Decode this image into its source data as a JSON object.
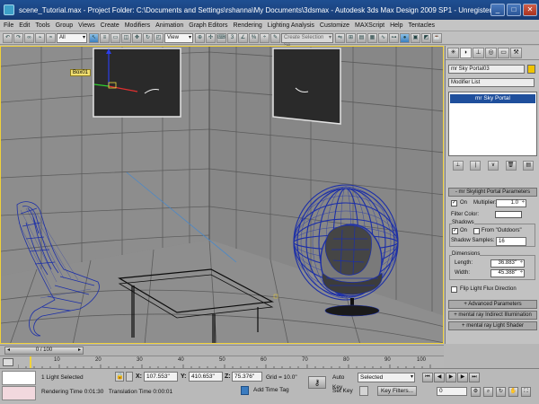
{
  "title_bar": {
    "text": "scene_Tutorial.max    - Project Folder: C:\\Documents and Settings\\rshanna\\My Documents\\3dsmax    - Autodesk 3ds Max Design 2009 SP1    - Unregistered Version    - Dis...",
    "minimize": "_",
    "maximize": "□",
    "close": "✕"
  },
  "menu": [
    "File",
    "Edit",
    "Tools",
    "Group",
    "Views",
    "Create",
    "Modifiers",
    "Animation",
    "Graph Editors",
    "Rendering",
    "Lighting Analysis",
    "Customize",
    "MAXScript",
    "Help",
    "Tentacles"
  ],
  "toolbar": {
    "filter_value": "All",
    "refcoord_value": "View",
    "named_selection_placeholder": "Create Selection Se"
  },
  "viewport": {
    "selected_object_tag": "Box01",
    "colors": {
      "border": "#f0d13a",
      "wire": "#1c2fa8",
      "grid": "#5c5c5c"
    }
  },
  "command_panel": {
    "object_name": "mr Sky Portal03",
    "modifier_list": "Modifier List",
    "stack_item": "mr Sky Portal",
    "rollout_params": "mr Skylight Portal Parameters",
    "on_label": "On",
    "on_checked": "✓",
    "multiplier_label": "Multiplier:",
    "multiplier_value": "1.0",
    "filter_color_label": "Filter Color:",
    "shadows_label": "Shadows",
    "shadows_on": "On",
    "shadows_from_outdoors": "From \"Outdoors\"",
    "shadow_samples_label": "Shadow Samples:",
    "shadow_samples_value": "16",
    "dimensions_label": "Dimensions",
    "length_label": "Length:",
    "length_value": "36.883\"",
    "width_label": "Width:",
    "width_value": "45.388\"",
    "flip_label": "Flip Light Flux Direction",
    "rollout_advanced": "Advanced Parameters",
    "rollout_indirect": "mental ray Indirect Illumination",
    "rollout_shader": "mental ray Light Shader",
    "collapse_sign": "+",
    "expand_sign": "-"
  },
  "timeline": {
    "frame_display": "0 / 100",
    "ticks": [
      "10",
      "20",
      "30",
      "40",
      "50",
      "60",
      "70",
      "80",
      "90",
      "100"
    ]
  },
  "status": {
    "selection": "1 Light Selected",
    "rendering_time": "Rendering Time  0:01:30",
    "translation_time": "Translation Time  0:00:01",
    "x_label": "X:",
    "x_value": "107.553\"",
    "y_label": "Y:",
    "y_value": "410.653\"",
    "z_label": "Z:",
    "z_value": "75.376\"",
    "grid": "Grid = 10.0\"",
    "add_time_tag": "Add Time Tag",
    "auto_key": "Auto Key",
    "set_key": "Set Key",
    "selected_mode": "Selected",
    "key_filters": "Key Filters...",
    "current_frame": "0"
  }
}
